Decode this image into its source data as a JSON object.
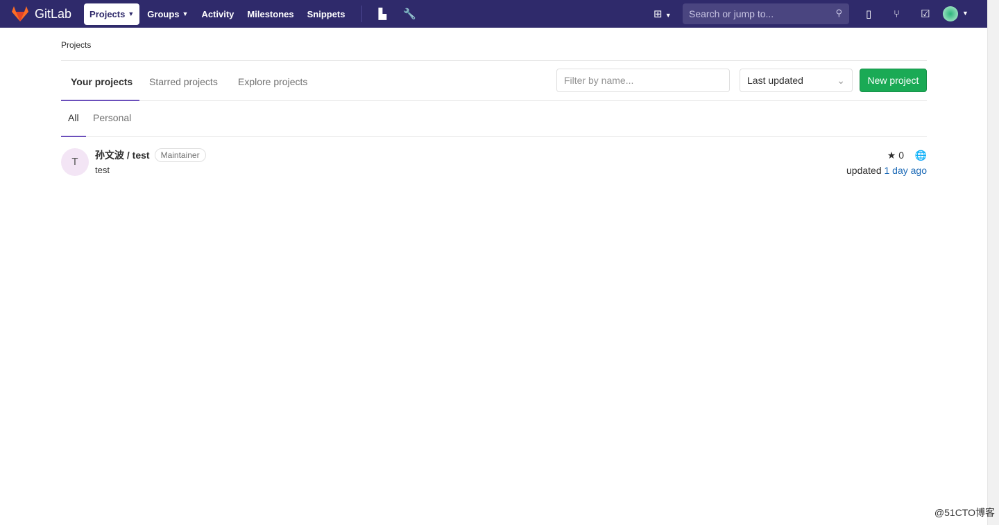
{
  "nav": {
    "brand": "GitLab",
    "items": [
      "Projects",
      "Groups",
      "Activity",
      "Milestones",
      "Snippets"
    ],
    "search_placeholder": "Search or jump to..."
  },
  "breadcrumb": "Projects",
  "tabs": [
    "Your projects",
    "Starred projects",
    "Explore projects"
  ],
  "filter_placeholder": "Filter by name...",
  "sort": "Last updated",
  "new_project": "New project",
  "subtabs": [
    "All",
    "Personal"
  ],
  "projects": [
    {
      "avatar": "T",
      "namespace": "孙文波",
      "name": "test",
      "role": "Maintainer",
      "description": "test",
      "stars": "0",
      "updated_prefix": "updated",
      "updated": "1 day ago"
    }
  ],
  "watermark": "@51CTO博客",
  "colors": {
    "nav": "#2f2a6b",
    "accent": "#6b4fbb",
    "new_button": "#1aaa55"
  }
}
